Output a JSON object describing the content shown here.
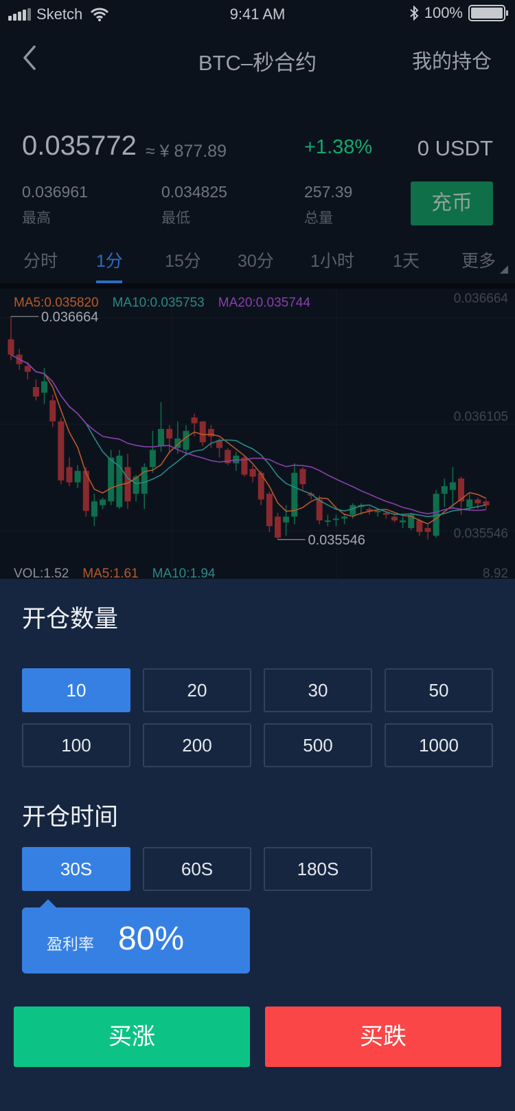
{
  "status_bar": {
    "carrier": "Sketch",
    "time": "9:41 AM",
    "battery": "100%"
  },
  "nav": {
    "title": "BTC–秒合约",
    "right_label": "我的持仓"
  },
  "ticker": {
    "price": "0.035772",
    "approx_cny": "≈ ¥ 877.89",
    "change": "+1.38%",
    "balance": "0 USDT",
    "high_value": "0.036961",
    "high_label": "最高",
    "low_value": "0.034825",
    "low_label": "最低",
    "volume_value": "257.39",
    "volume_label": "总量",
    "charge_label": "充币",
    "colors": {
      "up": "#14a86c",
      "accent": "#2e6cc1"
    }
  },
  "intervals": {
    "tabs": [
      "分时",
      "1分",
      "15分",
      "30分",
      "1小时",
      "1天",
      "更多"
    ],
    "active": "1分"
  },
  "chart": {
    "ma_legend": [
      {
        "text": "MA5:0.035820",
        "color": "#b85a2a"
      },
      {
        "text": "MA10:0.035753",
        "color": "#2a8a86"
      },
      {
        "text": "MA20:0.035744",
        "color": "#8a3fae"
      }
    ],
    "vol_legend": [
      {
        "text": "VOL:1.52",
        "color": "#8b9099"
      },
      {
        "text": "MA5:1.61",
        "color": "#b85a2a"
      },
      {
        "text": "MA10:1.94",
        "color": "#2a8a86"
      }
    ],
    "axis_labels": {
      "top": "0.036664",
      "mid": "0.036105",
      "bottom": "0.035546",
      "vol_max": "8.92"
    },
    "annotations": {
      "high": "0.036664",
      "low": "0.035546"
    }
  },
  "chart_data": {
    "type": "candlestick",
    "ylim": [
      0.035546,
      0.036664
    ],
    "candles": [
      {
        "o": 0.03655,
        "c": 0.03647,
        "h": 0.03667,
        "l": 0.03644
      },
      {
        "o": 0.03647,
        "c": 0.03642,
        "h": 0.0365,
        "l": 0.03639
      },
      {
        "o": 0.03641,
        "c": 0.03638,
        "h": 0.03643,
        "l": 0.03634
      },
      {
        "o": 0.0363,
        "c": 0.03625,
        "h": 0.03634,
        "l": 0.03623
      },
      {
        "o": 0.03627,
        "c": 0.03633,
        "h": 0.0364,
        "l": 0.03621
      },
      {
        "o": 0.03623,
        "c": 0.03612,
        "h": 0.03626,
        "l": 0.03609
      },
      {
        "o": 0.03612,
        "c": 0.03581,
        "h": 0.03614,
        "l": 0.03579
      },
      {
        "o": 0.03588,
        "c": 0.0358,
        "h": 0.03593,
        "l": 0.03578
      },
      {
        "o": 0.0358,
        "c": 0.03586,
        "h": 0.03589,
        "l": 0.03577
      },
      {
        "o": 0.03586,
        "c": 0.03565,
        "h": 0.03588,
        "l": 0.03562
      },
      {
        "o": 0.03562,
        "c": 0.0357,
        "h": 0.03574,
        "l": 0.03557
      },
      {
        "o": 0.03568,
        "c": 0.03571,
        "h": 0.03572,
        "l": 0.03566
      },
      {
        "o": 0.0357,
        "c": 0.03593,
        "h": 0.03597,
        "l": 0.03568
      },
      {
        "o": 0.03567,
        "c": 0.03594,
        "h": 0.03597,
        "l": 0.03566
      },
      {
        "o": 0.03588,
        "c": 0.0357,
        "h": 0.03595,
        "l": 0.03566
      },
      {
        "o": 0.03574,
        "c": 0.03583,
        "h": 0.03584,
        "l": 0.0357
      },
      {
        "o": 0.03574,
        "c": 0.03588,
        "h": 0.0359,
        "l": 0.03566
      },
      {
        "o": 0.03588,
        "c": 0.03597,
        "h": 0.03607,
        "l": 0.03585
      },
      {
        "o": 0.03599,
        "c": 0.03608,
        "h": 0.03622,
        "l": 0.03596
      },
      {
        "o": 0.03608,
        "c": 0.03603,
        "h": 0.0361,
        "l": 0.03595
      },
      {
        "o": 0.03598,
        "c": 0.03603,
        "h": 0.03612,
        "l": 0.03595
      },
      {
        "o": 0.03597,
        "c": 0.03607,
        "h": 0.0361,
        "l": 0.03594
      },
      {
        "o": 0.03614,
        "c": 0.03611,
        "h": 0.03616,
        "l": 0.03604
      },
      {
        "o": 0.03612,
        "c": 0.03601,
        "h": 0.03612,
        "l": 0.03599
      },
      {
        "o": 0.03608,
        "c": 0.03604,
        "h": 0.0361,
        "l": 0.03598
      },
      {
        "o": 0.03602,
        "c": 0.03598,
        "h": 0.03603,
        "l": 0.03593
      },
      {
        "o": 0.03597,
        "c": 0.0359,
        "h": 0.03598,
        "l": 0.03589
      },
      {
        "o": 0.0359,
        "c": 0.03594,
        "h": 0.03596,
        "l": 0.03586
      },
      {
        "o": 0.03593,
        "c": 0.03584,
        "h": 0.03594,
        "l": 0.03583
      },
      {
        "o": 0.03587,
        "c": 0.03583,
        "h": 0.03589,
        "l": 0.0358
      },
      {
        "o": 0.03585,
        "c": 0.03571,
        "h": 0.03586,
        "l": 0.03568
      },
      {
        "o": 0.03574,
        "c": 0.03557,
        "h": 0.03575,
        "l": 0.03554
      },
      {
        "o": 0.03562,
        "c": 0.03551,
        "h": 0.03564,
        "l": 0.0355
      },
      {
        "o": 0.03559,
        "c": 0.03562,
        "h": 0.03568,
        "l": 0.03552
      },
      {
        "o": 0.03562,
        "c": 0.03585,
        "h": 0.0359,
        "l": 0.03558
      },
      {
        "o": 0.03587,
        "c": 0.03579,
        "h": 0.03588,
        "l": 0.03576
      },
      {
        "o": 0.03574,
        "c": 0.03573,
        "h": 0.03575,
        "l": 0.03571
      },
      {
        "o": 0.03571,
        "c": 0.0356,
        "h": 0.03573,
        "l": 0.03558
      },
      {
        "o": 0.0356,
        "c": 0.0356,
        "h": 0.03563,
        "l": 0.03557
      },
      {
        "o": 0.03561,
        "c": 0.03561,
        "h": 0.03563,
        "l": 0.03557
      },
      {
        "o": 0.03561,
        "c": 0.03562,
        "h": 0.03563,
        "l": 0.03558
      },
      {
        "o": 0.03563,
        "c": 0.03568,
        "h": 0.03569,
        "l": 0.03561
      },
      {
        "o": 0.03567,
        "c": 0.03568,
        "h": 0.03569,
        "l": 0.03563
      },
      {
        "o": 0.03566,
        "c": 0.03565,
        "h": 0.03567,
        "l": 0.03563
      },
      {
        "o": 0.03565,
        "c": 0.03565,
        "h": 0.03566,
        "l": 0.03562
      },
      {
        "o": 0.03564,
        "c": 0.03563,
        "h": 0.03565,
        "l": 0.03561
      },
      {
        "o": 0.03562,
        "c": 0.0356,
        "h": 0.03563,
        "l": 0.03559
      },
      {
        "o": 0.03559,
        "c": 0.0356,
        "h": 0.03562,
        "l": 0.03556
      },
      {
        "o": 0.03556,
        "c": 0.03563,
        "h": 0.03564,
        "l": 0.03555
      },
      {
        "o": 0.0356,
        "c": 0.03554,
        "h": 0.03561,
        "l": 0.03552
      },
      {
        "o": 0.03556,
        "c": 0.03554,
        "h": 0.03558,
        "l": 0.0355
      },
      {
        "o": 0.03552,
        "c": 0.03574,
        "h": 0.03576,
        "l": 0.03551
      },
      {
        "o": 0.03574,
        "c": 0.03578,
        "h": 0.03582,
        "l": 0.03567
      },
      {
        "o": 0.03576,
        "c": 0.0358,
        "h": 0.03588,
        "l": 0.03566
      },
      {
        "o": 0.03582,
        "c": 0.0357,
        "h": 0.03583,
        "l": 0.03563
      },
      {
        "o": 0.03567,
        "c": 0.03571,
        "h": 0.03574,
        "l": 0.03565
      },
      {
        "o": 0.03571,
        "c": 0.03569,
        "h": 0.03572,
        "l": 0.03566
      },
      {
        "o": 0.0357,
        "c": 0.03568,
        "h": 0.03571,
        "l": 0.03566
      }
    ]
  },
  "order": {
    "quantity_title": "开仓数量",
    "quantities": [
      "10",
      "20",
      "30",
      "50",
      "100",
      "200",
      "500",
      "1000"
    ],
    "quantity_selected": "10",
    "time_title": "开仓时间",
    "times": [
      "30S",
      "60S",
      "180S"
    ],
    "time_selected": "30S",
    "rate_label": "盈利率",
    "rate_value": "80%",
    "buy_up_label": "买涨",
    "buy_down_label": "买跌",
    "colors": {
      "up": "#0cc385",
      "down": "#fb4648",
      "active": "#3680e3"
    }
  }
}
